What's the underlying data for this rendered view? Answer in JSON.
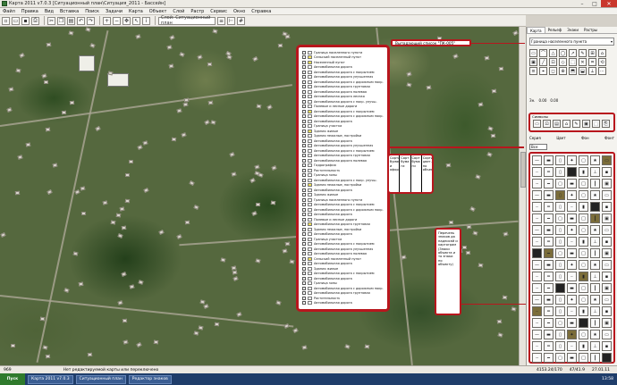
{
  "window": {
    "title": "Карта 2011 v7.0.3 [Ситуационный план\\Ситуация_2011 - Бассейн]"
  },
  "menu": [
    "Файл",
    "Правка",
    "Вид",
    "Вставка",
    "Поиск",
    "Задачи",
    "Карта",
    "Объект",
    "Слой",
    "Растр",
    "Сервис",
    "Окно",
    "Справка"
  ],
  "toolbar": {
    "layer_select": "Слой: Ситуационный план"
  },
  "layer_list": {
    "items": [
      {
        "label": "Граница населенного пункта",
        "swatch": "#ffffff"
      },
      {
        "label": "Сельский населенный пункт",
        "swatch": "#f4e35a"
      },
      {
        "label": "Населенный пункт",
        "swatch": "#f4e35a"
      },
      {
        "label": "Автомобильная дорога",
        "swatch": "#ffffff"
      },
      {
        "label": "Автомобильная дорога с покрытием",
        "swatch": "#ffffff"
      },
      {
        "label": "Автомобильная дорога улучшенная",
        "swatch": "#ffffff"
      },
      {
        "label": "Автомобильная дорога с дорожным покр.",
        "swatch": "#ffffff"
      },
      {
        "label": "Автомобильная дорога грунтовая",
        "swatch": "#ffffff"
      },
      {
        "label": "Автомобильная дорога полевая",
        "swatch": "#ffffff"
      },
      {
        "label": "Автомобильная дорога лесная",
        "swatch": "#ffffff"
      },
      {
        "label": "Автомобильная дорога с покр. улучш.",
        "swatch": "#ffffff"
      },
      {
        "label": "Полевые и лесные дороги",
        "swatch": "#ffffff"
      },
      {
        "label": "Автомобильная дорога с покрытием",
        "swatch": "#f4e35a"
      },
      {
        "label": "Автомобильная дорога с дорожным покр.",
        "swatch": "#ffffff"
      },
      {
        "label": "Автомобильная дорога",
        "swatch": "#ffffff"
      },
      {
        "label": "Граница участка",
        "swatch": "#ffffff"
      },
      {
        "label": "Здания жилые",
        "swatch": "#f4e35a"
      },
      {
        "label": "Здания нежилые, постройки",
        "swatch": "#ffffff"
      },
      {
        "label": "Автомобильная дорога",
        "swatch": "#ffffff"
      },
      {
        "label": "Автомобильная дорога улучшенная",
        "swatch": "#ffffff"
      },
      {
        "label": "Автомобильная дорога с покрытием",
        "swatch": "#ffffff"
      },
      {
        "label": "Автомобильная дорога грунтовая",
        "swatch": "#ffffff"
      },
      {
        "label": "Автомобильная дорога полевая",
        "swatch": "#ffffff"
      },
      {
        "label": "Гидрография",
        "swatch": "#ffffff"
      },
      {
        "label": "Растительность",
        "swatch": "#ffffff"
      },
      {
        "label": "Граница зоны",
        "swatch": "#ffffff"
      },
      {
        "label": "Автомобильная дорога с покр. улучш.",
        "swatch": "#ffffff"
      },
      {
        "label": "Здания нежилые, постройки",
        "swatch": "#f4e35a"
      },
      {
        "label": "Автомобильная дорога",
        "swatch": "#ffffff"
      },
      {
        "label": "Здания жилые",
        "swatch": "#ffffff"
      },
      {
        "label": "Граница населенного пункта",
        "swatch": "#ffffff"
      },
      {
        "label": "Автомобильная дорога с покрытием",
        "swatch": "#ffffff"
      },
      {
        "label": "Автомобильная дорога с дорожным покр.",
        "swatch": "#ffffff"
      },
      {
        "label": "Автомобильная дорога",
        "swatch": "#ffffff"
      },
      {
        "label": "Полевые и лесные дороги",
        "swatch": "#ffffff"
      },
      {
        "label": "Автомобильная дорога грунтовая",
        "swatch": "#f4e35a"
      },
      {
        "label": "Здания нежилые, постройки",
        "swatch": "#ffffff"
      },
      {
        "label": "Автомобильная дорога",
        "swatch": "#ffffff"
      },
      {
        "label": "Граница участка",
        "swatch": "#ffffff"
      },
      {
        "label": "Автомобильная дорога с покрытием",
        "swatch": "#ffffff"
      },
      {
        "label": "Автомобильная дорога улучшенная",
        "swatch": "#ffffff"
      },
      {
        "label": "Автомобильная дорога полевая",
        "swatch": "#ffffff"
      },
      {
        "label": "Сельский населенный пункт",
        "swatch": "#f4e35a"
      },
      {
        "label": "Автомобильная дорога",
        "swatch": "#ffffff"
      },
      {
        "label": "Здания жилые",
        "swatch": "#ffffff"
      },
      {
        "label": "Автомобильная дорога с покрытием",
        "swatch": "#ffffff"
      },
      {
        "label": "Автомобильная дорога",
        "swatch": "#ffffff"
      },
      {
        "label": "Граница зоны",
        "swatch": "#ffffff"
      },
      {
        "label": "Автомобильная дорога с дорожным покр.",
        "swatch": "#ffffff"
      },
      {
        "label": "Автомобильная дорога грунтовая",
        "swatch": "#ffffff"
      },
      {
        "label": "Растительность",
        "swatch": "#ffffff"
      },
      {
        "label": "Автомобильная дорога",
        "swatch": "#ffffff"
      }
    ]
  },
  "callouts": {
    "top_label": "Выпадающий список \"ПК-005\"",
    "column_headers": [
      "Сорта бумаг и оформления",
      "Сорт бума ги",
      "Сорт бума ги",
      "Сортир. цвет. по объект."
    ],
    "note": "Перечень знаков да надписей и картограм (Знаки объекта и то знаки по объекту)"
  },
  "panel": {
    "tabs": [
      "Карта",
      "Рельеф",
      "Знаки",
      "Растры"
    ],
    "layer_select": "Граница населенного пункта",
    "size_label": "Зн.",
    "size_values": [
      "0.00",
      "0.00"
    ],
    "section_label": "Символы",
    "bottom_labels": [
      "Серия",
      "Цвет",
      "Фон",
      "Фонт"
    ],
    "dropdown_label": "Все"
  },
  "status": {
    "left": "969",
    "center": "Нет редактируемой карты или переключено",
    "coords": [
      "4153.24/170",
      "47/41.9"
    ],
    "time": "27.01.11"
  },
  "taskbar": {
    "start": "Пуск",
    "tasks": [
      "Карта 2011 v7.0.3",
      "Ситуационный план",
      "Редактор знаков"
    ],
    "clock": "13:58"
  }
}
